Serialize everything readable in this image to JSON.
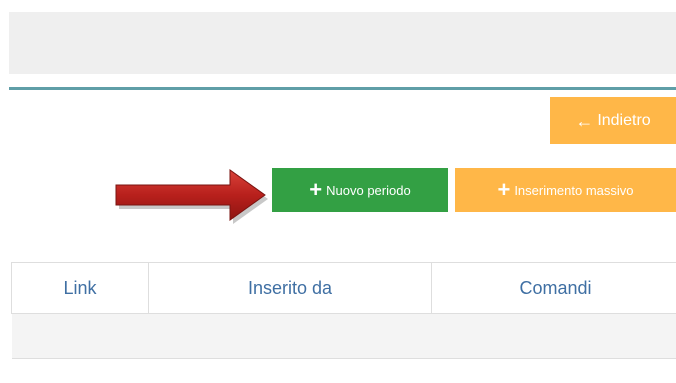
{
  "toolbar": {
    "back_icon": "arrow-left-icon",
    "back_label": "Indietro",
    "new_period_icon": "plus-icon",
    "new_period_label": "Nuovo periodo",
    "bulk_insert_icon": "plus-icon",
    "bulk_insert_label": "Inserimento massivo"
  },
  "table": {
    "columns": [
      "Link",
      "Inserito da",
      "Comandi"
    ]
  },
  "colors": {
    "orange": "#ffb748",
    "green": "#33a044",
    "teal": "#5f9ea7",
    "header_text": "#3f6fa3",
    "arrow_red": "#b8201c"
  }
}
